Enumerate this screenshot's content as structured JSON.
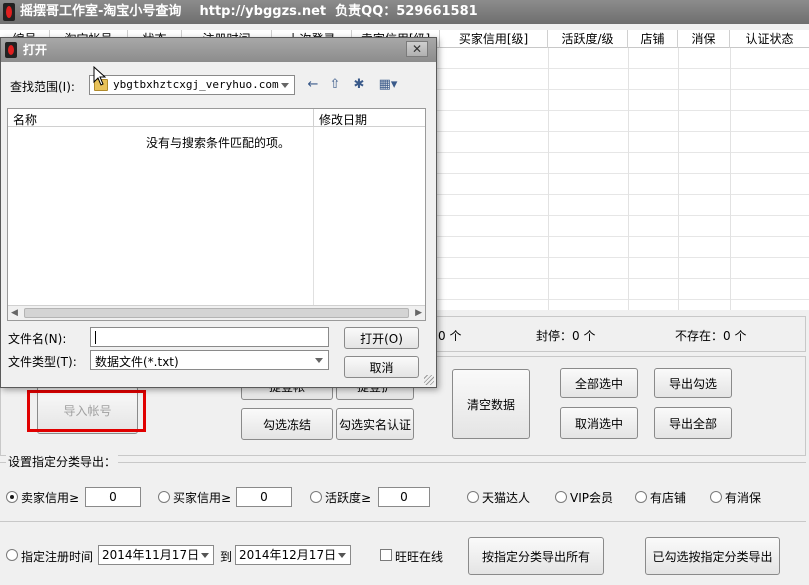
{
  "window": {
    "title": "摇摆哥工作室-淘宝小号查询    http://ybggzs.net  负责QQ：529661581"
  },
  "columns": [
    "编号",
    "淘宝帐号",
    "状态",
    "注册时间",
    "上次登录",
    "卖家信用[级]",
    "买家信用[级]",
    "活跃度/级",
    "店铺",
    "消保",
    "认证状态"
  ],
  "stats": {
    "item1": "0 个",
    "freeze": "封停：0 个",
    "notexist": "不存在：0 个"
  },
  "buttons": {
    "import": "导入帐号",
    "hidden1": "提登帐",
    "hidden2": "提登护",
    "select_frozen": "勾选冻结",
    "select_realname": "勾选实名认证",
    "clear_data": "清空数据",
    "select_all": "全部选中",
    "export_checked": "导出勾选",
    "cancel_select": "取消选中",
    "export_all": "导出全部"
  },
  "category_export": {
    "label": "设置指定分类导出：",
    "seller_credit": "卖家信用≥",
    "seller_value": "0",
    "buyer_credit": "买家信用≥",
    "buyer_value": "0",
    "activity": "活跃度≥",
    "activity_value": "0",
    "tmall": "天猫达人",
    "vip": "VIP会员",
    "has_shop": "有店铺",
    "has_guarantee": "有消保",
    "reg_time": "指定注册时间",
    "date_from": "2014年11月17日",
    "to": "到",
    "date_to": "2014年12月17日",
    "wangwang_online": "旺旺在线",
    "export_by_category_all": "按指定分类导出所有",
    "export_checked_by_category": "已勾选按指定分类导出"
  },
  "dialog": {
    "title": "打开",
    "close": "✕",
    "lookin_label": "查找范围(I):",
    "lookin_value": "ybgtbxhztcxgj_veryhuo.com",
    "col_name": "名称",
    "col_date": "修改日期",
    "empty_msg": "没有与搜索条件匹配的项。",
    "filename_label": "文件名(N):",
    "filename_value": "",
    "filetype_label": "文件类型(T):",
    "filetype_value": "数据文件(*.txt)",
    "open_button": "打开(O)",
    "cancel_button": "取消"
  }
}
